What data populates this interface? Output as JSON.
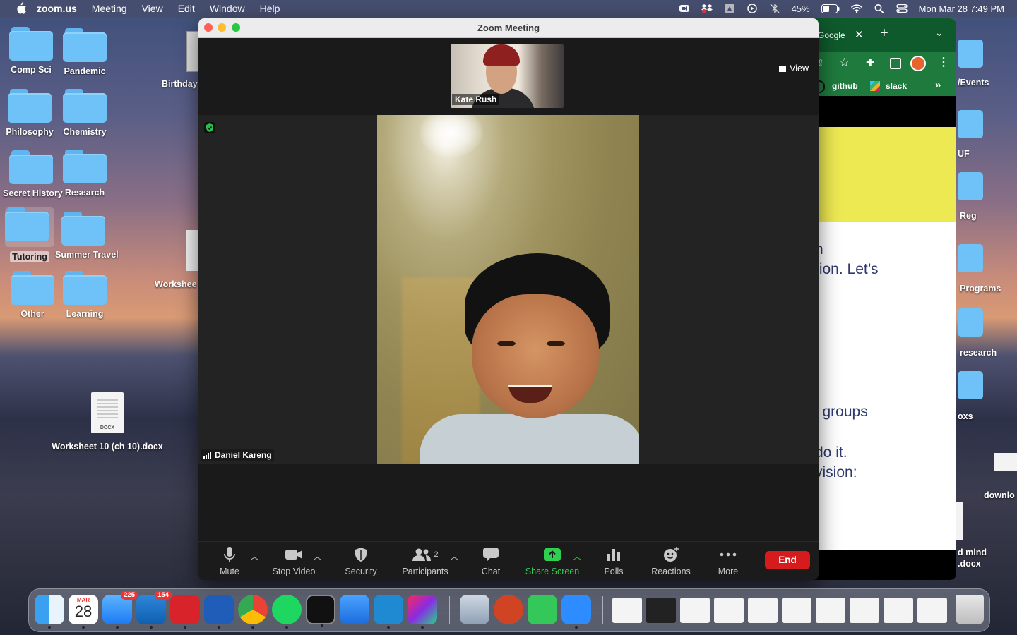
{
  "menubar": {
    "app": "zoom.us",
    "items": [
      "Meeting",
      "View",
      "Edit",
      "Window",
      "Help"
    ],
    "battery": "45%",
    "datetime": "Mon Mar 28  7:49 PM"
  },
  "desktop": {
    "folders_left": [
      {
        "label": "Comp Sci"
      },
      {
        "label": "Pandemic"
      },
      {
        "label": "Philosophy"
      },
      {
        "label": "Chemistry"
      },
      {
        "label": "Secret History"
      },
      {
        "label": "Research"
      },
      {
        "label": "Tutoring"
      },
      {
        "label": "Summer Travel"
      },
      {
        "label": "Other"
      },
      {
        "label": "Learning"
      }
    ],
    "partial_labels": {
      "birthday": "Birthday",
      "worksheet": "Workshee"
    },
    "file": {
      "label": "Worksheet 10 (ch 10).docx",
      "ext": "DOCX"
    },
    "right_labels": [
      "/Events",
      "UF",
      "Reg",
      "Programs",
      "research",
      "oxs",
      "downlo",
      "d mind",
      ".docx"
    ]
  },
  "chrome": {
    "tab_label": "Google",
    "bookmarks": [
      "github",
      "slack"
    ],
    "page_lines": [
      "n",
      "tion. Let’s",
      "l groups",
      "do it.",
      "vision:"
    ]
  },
  "zoom": {
    "window_title": "Zoom Meeting",
    "view_label": "View",
    "thumbnail_name": "Kate Rush",
    "speaker_name": "Daniel Kareng",
    "toolbar": {
      "mute": "Mute",
      "stop_video": "Stop Video",
      "security": "Security",
      "participants": "Participants",
      "participants_count": "2",
      "chat": "Chat",
      "share_screen": "Share Screen",
      "polls": "Polls",
      "reactions": "Reactions",
      "more": "More",
      "end": "End"
    }
  },
  "dock": {
    "calendar_month": "MAR",
    "calendar_day": "28",
    "mail_badge": "225",
    "outlook_badge": "154"
  },
  "colors": {
    "share_green": "#2fd050",
    "end_red": "#d51b1b",
    "folder_blue": "#6fc2f7",
    "chrome_green": "#1e7a3d",
    "highlight_yellow": "#ede953"
  }
}
